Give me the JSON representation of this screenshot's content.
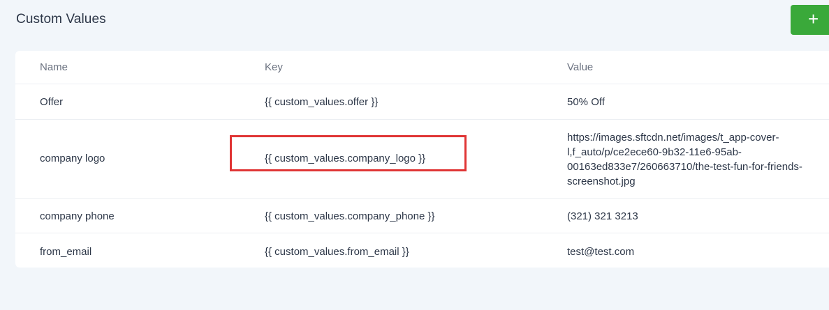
{
  "page": {
    "title": "Custom Values",
    "add_label": "+"
  },
  "table": {
    "headers": {
      "name": "Name",
      "key": "Key",
      "value": "Value"
    },
    "rows": [
      {
        "name": "Offer",
        "key": "{{ custom_values.offer }}",
        "value": "50% Off"
      },
      {
        "name": "company logo",
        "key": "{{ custom_values.company_logo }}",
        "value": "https://images.sftcdn.net/images/t_app-cover-\nl,f_auto/p/ce2ece60-9b32-11e6-95ab-\n00163ed833e7/260663710/the-test-fun-for-friends-\nscreenshot.jpg"
      },
      {
        "name": "company phone",
        "key": "{{ custom_values.company_phone }}",
        "value": "(321) 321 3213"
      },
      {
        "name": "from_email",
        "key": "{{ custom_values.from_email }}",
        "value": "test@test.com"
      }
    ]
  },
  "colors": {
    "accent_green": "#3aa93a",
    "highlight_red": "#e03535",
    "background": "#f2f6fa"
  }
}
